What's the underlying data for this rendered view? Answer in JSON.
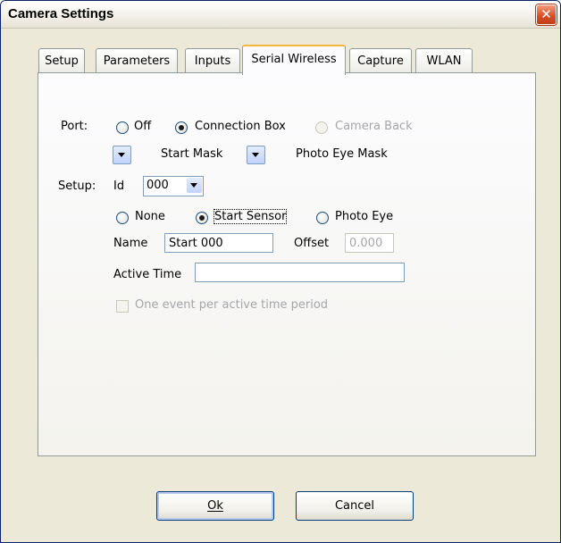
{
  "window": {
    "title": "Camera Settings",
    "close_glyph": "✕"
  },
  "tabs": [
    {
      "label": "Setup"
    },
    {
      "label": "Parameters"
    },
    {
      "label": "Inputs"
    },
    {
      "label": "Serial Wireless",
      "active": true
    },
    {
      "label": "Capture"
    },
    {
      "label": "WLAN"
    }
  ],
  "port": {
    "label": "Port:",
    "options": [
      {
        "label": "Off",
        "checked": false,
        "disabled": false
      },
      {
        "label": "Connection Box",
        "checked": true,
        "disabled": false
      },
      {
        "label": "Camera Back",
        "checked": false,
        "disabled": true
      }
    ],
    "start_mask_label": "Start Mask",
    "photo_eye_mask_label": "Photo Eye Mask"
  },
  "setup": {
    "label": "Setup:",
    "id_label": "Id",
    "id_value": "000",
    "types": [
      {
        "label": "None",
        "checked": false
      },
      {
        "label": "Start Sensor",
        "checked": true
      },
      {
        "label": "Photo Eye",
        "checked": false
      }
    ],
    "name_label": "Name",
    "name_value": "Start 000",
    "offset_label": "Offset",
    "offset_value": "0.000",
    "active_time_label": "Active Time",
    "active_time_value": "",
    "one_event_label": "One event per active time period",
    "one_event_checked": false
  },
  "buttons": {
    "ok": "Ok",
    "cancel": "Cancel"
  }
}
